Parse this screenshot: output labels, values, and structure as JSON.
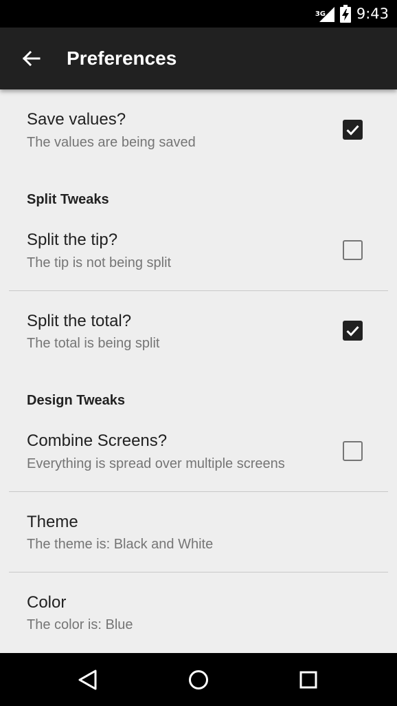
{
  "status_bar": {
    "network_type": "3G",
    "time": "9:43"
  },
  "app_bar": {
    "title": "Preferences",
    "back_icon": "arrow-left-icon"
  },
  "preferences": {
    "save_values": {
      "title": "Save values?",
      "summary": "The values are being saved",
      "checked": true
    },
    "split_category": "Split Tweaks",
    "split_tip": {
      "title": "Split the tip?",
      "summary": "The tip is not being split",
      "checked": false
    },
    "split_total": {
      "title": "Split the total?",
      "summary": "The total is being split",
      "checked": true
    },
    "design_category": "Design Tweaks",
    "combine_screens": {
      "title": "Combine Screens?",
      "summary": "Everything is spread over multiple screens",
      "checked": false
    },
    "theme": {
      "title": "Theme",
      "summary": "The theme is: Black and White"
    },
    "color": {
      "title": "Color",
      "summary": "The color is: Blue"
    }
  },
  "nav_bar": {
    "icons": [
      "back-triangle-icon",
      "home-circle-icon",
      "recents-square-icon"
    ]
  },
  "colors": {
    "app_bar": "#212121",
    "background": "#eeeeee",
    "checkbox_checked": "#212121",
    "secondary_text": "#757575"
  }
}
